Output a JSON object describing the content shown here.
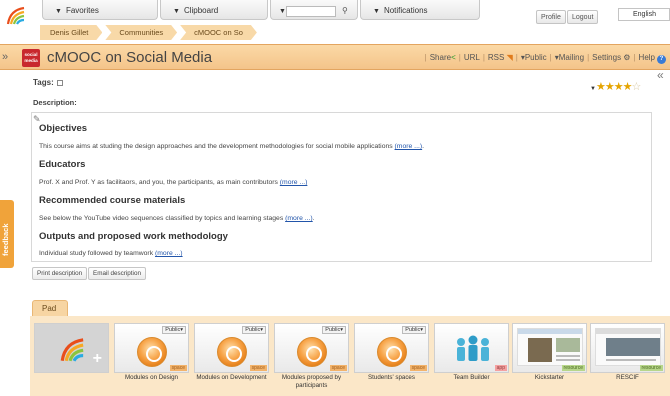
{
  "topbar": {
    "favorites": "Favorites",
    "clipboard": "Clipboard",
    "notifications": "Notifications",
    "profile": "Profile",
    "logout": "Logout",
    "language": "English"
  },
  "breadcrumb": [
    "Denis Gillet",
    "Communities",
    "cMOOC on So"
  ],
  "header": {
    "logo_text": "social media",
    "title": "cMOOC on Social Media",
    "menu": {
      "share": "Share",
      "url": "URL",
      "rss": "RSS",
      "public": "Public",
      "mailing": "Mailing",
      "settings": "Settings",
      "help": "Help"
    }
  },
  "feedback_tab": "feedback",
  "tags_label": "Tags:",
  "rating": {
    "value": 4,
    "max": 5
  },
  "description": {
    "label": "Description:",
    "sections": [
      {
        "heading": "Objectives",
        "text": "This course aims at studing the design approaches and the development methodologies for social mobile applications",
        "link": "(more ...)",
        "after": "."
      },
      {
        "heading": "Educators",
        "text": "Prof. X and Prof. Y as facilitaors, and you, the participants, as main contributors",
        "link": "(more ...)",
        "after": ""
      },
      {
        "heading": "Recommended course materials",
        "text": "See below the YouTube video sequences classified by topics and learning stages",
        "link": "(more ...)",
        "after": "."
      },
      {
        "heading": "Outputs and proposed work methodology",
        "text": "Individual study followed by teamwork",
        "link": "(more ...)",
        "after": ""
      }
    ]
  },
  "actions": {
    "print": "Print description",
    "email": "Email description"
  },
  "pad": {
    "tab_label": "Pad",
    "public_label": "Public",
    "tiles": [
      {
        "label": "Modules on Design",
        "tag": "space"
      },
      {
        "label": "Modules on Development",
        "tag": "space"
      },
      {
        "label": "Modules proposed by participants",
        "tag": "space"
      },
      {
        "label": "Students' spaces",
        "tag": "space"
      },
      {
        "label": "Team Builder",
        "tag": "app"
      },
      {
        "label": "Kickstarter",
        "tag": "resource"
      },
      {
        "label": "RESCIF",
        "tag": "resource"
      }
    ]
  },
  "colors": {
    "band": "#f4c48a",
    "accent_orange": "#f0a33a",
    "link": "#2255aa",
    "share_green": "#2a9a2a"
  }
}
